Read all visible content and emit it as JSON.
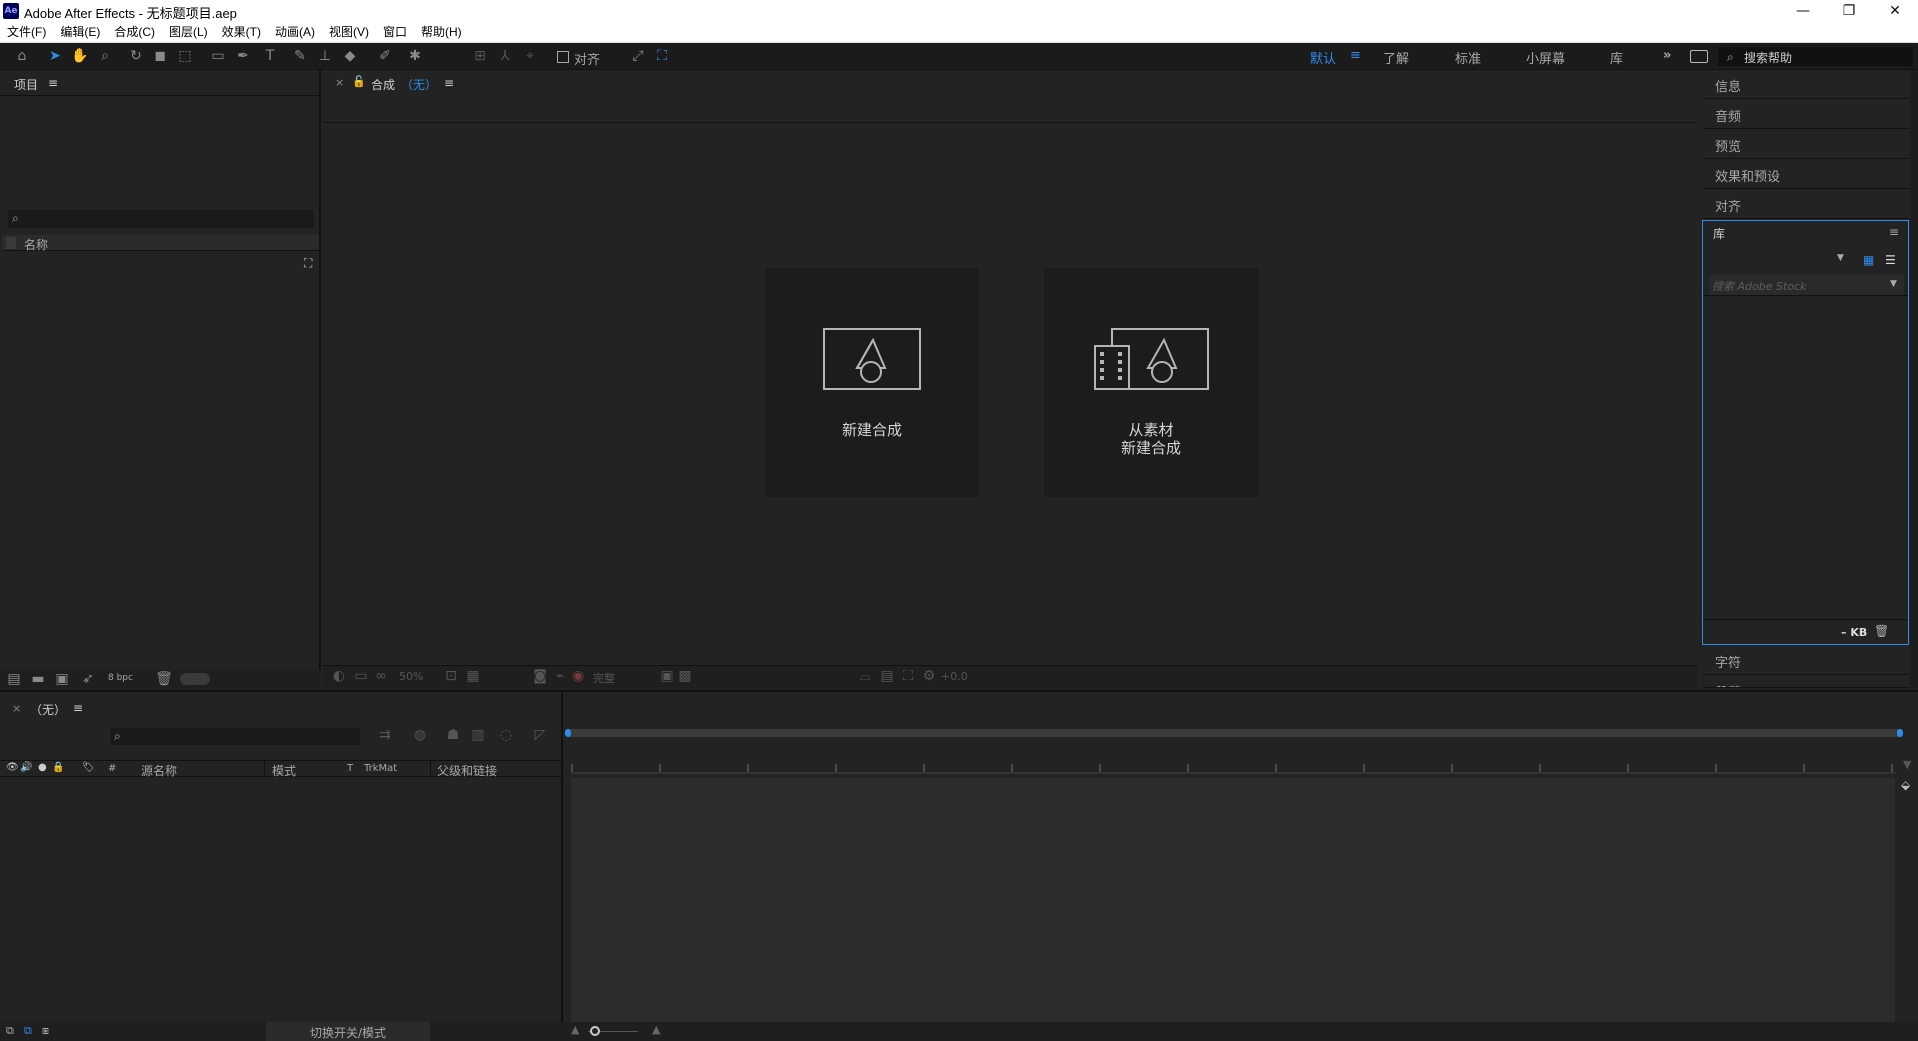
{
  "window": {
    "app_icon": "Ae",
    "title": "Adobe After Effects - 无标题项目.aep",
    "minimize": "—",
    "restore": "❐",
    "close": "✕"
  },
  "menu": [
    "文件(F)",
    "编辑(E)",
    "合成(C)",
    "图层(L)",
    "效果(T)",
    "动画(A)",
    "视图(V)",
    "窗口",
    "帮助(H)"
  ],
  "toolbar": {
    "snap_label": "对齐",
    "workspaces": [
      "默认",
      "了解",
      "标准",
      "小屏幕",
      "库"
    ],
    "active_workspace": "默认",
    "more": "»",
    "help_search": "搜索帮助"
  },
  "project": {
    "tab": "项目",
    "menu_icon": "≡",
    "search_placeholder": "",
    "column_name": "名称",
    "bpc": "8 bpc"
  },
  "composition": {
    "tab_prefix": "合成",
    "tab_name": "（无）",
    "menu_icon": "≡",
    "new_comp_label": "新建合成",
    "from_footage_line1": "从素材",
    "from_footage_line2": "新建合成",
    "zoom": "50%",
    "quality": "完整",
    "exposure": "+0.0"
  },
  "right_panels": {
    "items": [
      "信息",
      "音频",
      "预览",
      "效果和预设",
      "对齐"
    ],
    "library_title": "库",
    "library_search_placeholder": "搜索 Adobe Stock",
    "library_size": "– KB",
    "bottom_items": [
      "字符",
      "段落"
    ]
  },
  "timeline": {
    "tab_name": "（无）",
    "menu_icon": "≡",
    "columns": {
      "hash": "#",
      "source_name": "源名称",
      "mode": "模式",
      "t": "T",
      "trkmat": "TrkMat",
      "parent": "父级和链接"
    },
    "toggle_label": "切换开关/模式"
  },
  "colors": {
    "accent": "#2d8ceb",
    "panel_bg": "#232323",
    "dark_bg": "#1b1b1b"
  }
}
